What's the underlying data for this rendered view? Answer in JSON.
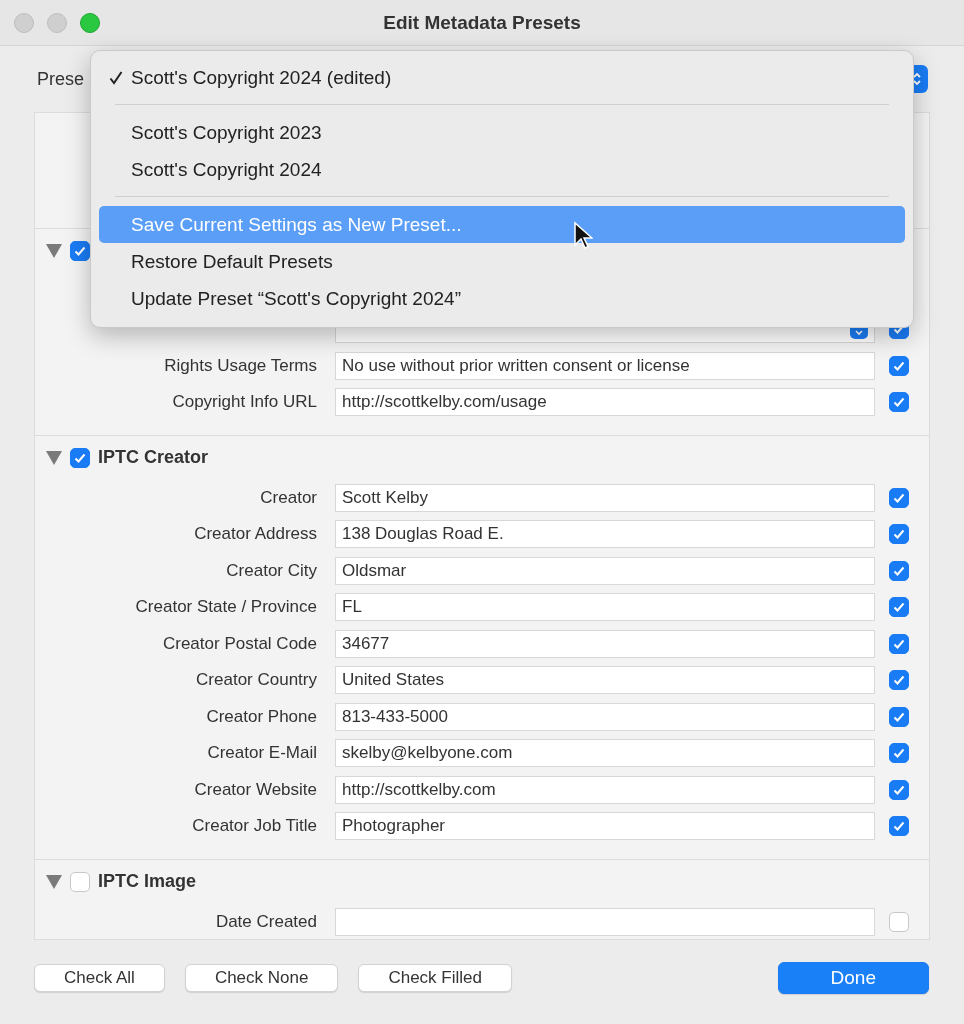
{
  "window": {
    "title": "Edit Metadata Presets"
  },
  "preset": {
    "label": "Prese"
  },
  "sections": [
    {
      "kind": "blank"
    },
    {
      "kind": "group",
      "expanded": true,
      "checked": true,
      "rows": [
        {
          "kind": "popup",
          "checked": true
        },
        {
          "kind": "text",
          "label": "Rights Usage Terms",
          "value": "No use without prior written consent or license",
          "checked": true
        },
        {
          "kind": "text",
          "label": "Copyright Info URL",
          "value": "http://scottkelby.com/usage",
          "checked": true
        }
      ]
    },
    {
      "kind": "group",
      "title": "IPTC Creator",
      "expanded": true,
      "checked": true,
      "rows": [
        {
          "kind": "text",
          "label": "Creator",
          "value": "Scott Kelby",
          "checked": true
        },
        {
          "kind": "text",
          "label": "Creator Address",
          "value": "138 Douglas Road E.",
          "checked": true
        },
        {
          "kind": "text",
          "label": "Creator City",
          "value": "Oldsmar",
          "checked": true
        },
        {
          "kind": "text",
          "label": "Creator State / Province",
          "value": "FL",
          "checked": true
        },
        {
          "kind": "text",
          "label": "Creator Postal Code",
          "value": "34677",
          "checked": true
        },
        {
          "kind": "text",
          "label": "Creator Country",
          "value": "United States",
          "checked": true
        },
        {
          "kind": "text",
          "label": "Creator Phone",
          "value": "813-433-5000",
          "checked": true
        },
        {
          "kind": "text",
          "label": "Creator E-Mail",
          "value": "skelby@kelbyone.com",
          "checked": true
        },
        {
          "kind": "text",
          "label": "Creator Website",
          "value": "http://scottkelby.com",
          "checked": true
        },
        {
          "kind": "text",
          "label": "Creator Job Title",
          "value": "Photographer",
          "checked": true
        }
      ]
    },
    {
      "kind": "group",
      "title": "IPTC Image",
      "expanded": true,
      "checked": false,
      "rows": [
        {
          "kind": "text",
          "label": "Date Created",
          "checked": false
        }
      ]
    }
  ],
  "menu": {
    "items": [
      {
        "kind": "item",
        "label": "Scott's Copyright 2024 (edited)",
        "checked": true,
        "selected": false
      },
      {
        "kind": "separator"
      },
      {
        "kind": "item",
        "label": "Scott's Copyright 2023",
        "checked": false,
        "selected": false
      },
      {
        "kind": "item",
        "label": "Scott's Copyright 2024",
        "checked": false,
        "selected": false
      },
      {
        "kind": "separator"
      },
      {
        "kind": "item",
        "label": "Save Current Settings as New Preset...",
        "checked": false,
        "selected": true
      },
      {
        "kind": "item",
        "label": "Restore Default Presets",
        "checked": false,
        "selected": false
      },
      {
        "kind": "item",
        "label": "Update Preset “Scott's Copyright 2024”",
        "checked": false,
        "selected": false
      }
    ]
  },
  "buttons": [
    {
      "label": "Check All",
      "kind": "plain"
    },
    {
      "label": "Check None",
      "kind": "plain"
    },
    {
      "label": "Check Filled",
      "kind": "plain"
    },
    {
      "label": "Done",
      "kind": "default"
    }
  ]
}
